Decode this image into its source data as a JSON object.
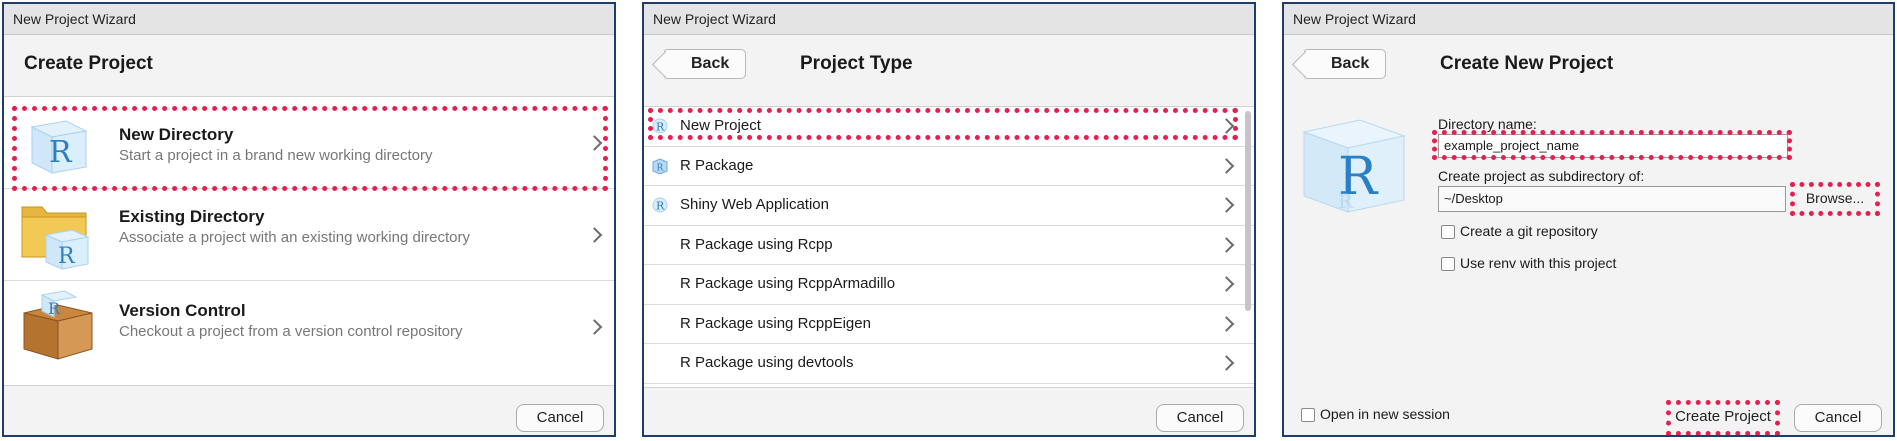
{
  "panel1": {
    "window_title": "New Project Wizard",
    "header": "Create Project",
    "rows": [
      {
        "title": "New Directory",
        "desc": "Start a project in a brand new working directory"
      },
      {
        "title": "Existing Directory",
        "desc": "Associate a project with an existing working directory"
      },
      {
        "title": "Version Control",
        "desc": "Checkout a project from a version control repository"
      }
    ],
    "cancel": "Cancel"
  },
  "panel2": {
    "window_title": "New Project Wizard",
    "back": "Back",
    "header": "Project Type",
    "items": [
      {
        "label": "New Project",
        "icon": "r-logo-icon"
      },
      {
        "label": "R Package",
        "icon": "r-package-icon"
      },
      {
        "label": "Shiny Web Application",
        "icon": "r-logo-icon"
      },
      {
        "label": "R Package using Rcpp",
        "icon": ""
      },
      {
        "label": "R Package using RcppArmadillo",
        "icon": ""
      },
      {
        "label": "R Package using RcppEigen",
        "icon": ""
      },
      {
        "label": "R Package using devtools",
        "icon": ""
      }
    ],
    "cancel": "Cancel"
  },
  "panel3": {
    "window_title": "New Project Wizard",
    "back": "Back",
    "header": "Create New Project",
    "dir_name_label": "Directory name:",
    "dir_name_value": "example_project_name",
    "subdir_label": "Create project as subdirectory of:",
    "subdir_value": "~/Desktop",
    "browse": "Browse...",
    "git_label": "Create a git repository",
    "renv_label": "Use renv with this project",
    "open_session_label": "Open in new session",
    "create": "Create Project",
    "cancel": "Cancel"
  },
  "colors": {
    "highlight": "#e5204f",
    "panel_border": "#1f3d6b",
    "r_blue": "#2b7fc4"
  }
}
